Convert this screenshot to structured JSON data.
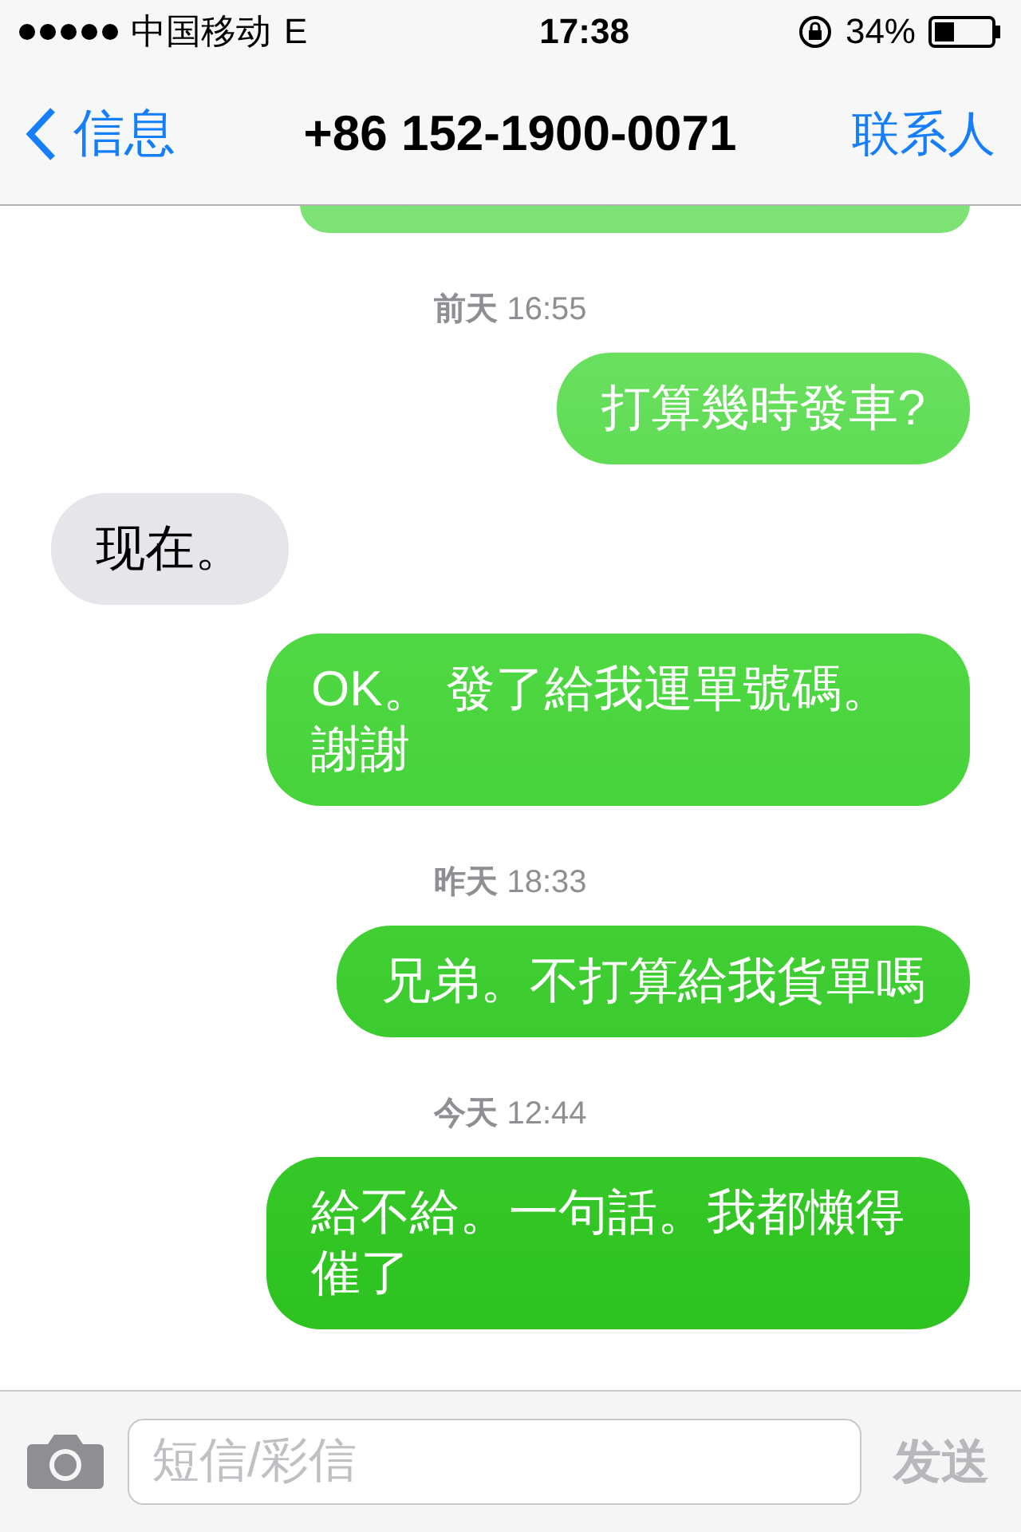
{
  "status_bar": {
    "carrier": "中国移动",
    "network": "E",
    "time": "17:38",
    "battery": "34%"
  },
  "nav": {
    "back": "信息",
    "title": "+86 152-1900-0071",
    "action": "联系人"
  },
  "messages": [
    {
      "kind": "timestamp",
      "text": "**前天** 16:55"
    },
    {
      "kind": "outgoing",
      "text": "打算幾時發車?"
    },
    {
      "kind": "incoming",
      "text": "现在。"
    },
    {
      "kind": "outgoing",
      "text": "OK。 發了給我運單號碼。謝謝"
    },
    {
      "kind": "timestamp",
      "text": "**昨天** 18:33"
    },
    {
      "kind": "outgoing",
      "text": "兄弟。不打算給我貨單嗎"
    },
    {
      "kind": "timestamp",
      "text": "**今天** 12:44"
    },
    {
      "kind": "outgoing",
      "text": "給不給。一句話。我都懶得催了"
    }
  ],
  "composer": {
    "placeholder": "短信/彩信",
    "send": "发送",
    "send_disabled": true
  }
}
